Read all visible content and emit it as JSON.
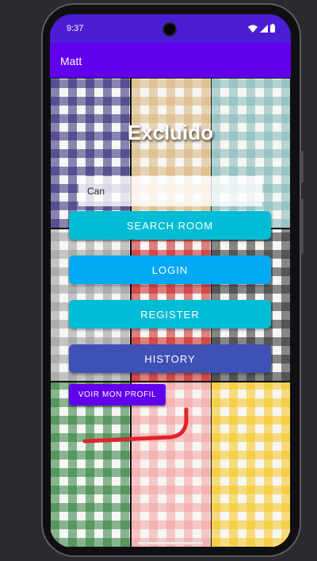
{
  "status_bar": {
    "time": "9:37",
    "icons": [
      "wifi-icon",
      "signal-icon",
      "battery-icon"
    ]
  },
  "app_bar": {
    "title": "Matt"
  },
  "main": {
    "headline": "Excluido",
    "search": {
      "value": "Can",
      "placeholder": ""
    },
    "buttons": {
      "search_room": "SEARCH ROOM",
      "login": "LOGIN",
      "register": "REGISTER",
      "history": "HISTORY",
      "profile": "VOIR MON PROFIL"
    }
  },
  "colors": {
    "status_bar": "#4b1ed6",
    "app_bar": "#6200ee",
    "search_room_button": "#00bcd4",
    "login_button": "#03a9f4",
    "register_button": "#00bcd4",
    "history_button": "#3f51b5",
    "profile_button": "#6200ee",
    "annotation_stroke": "#e0242c",
    "tile_colors": [
      "#2d2577",
      "#d9b57b",
      "#7fb7b7",
      "#9a9a9a",
      "#c81e1e",
      "#2c2c2c",
      "#2e7d3a",
      "#f4a1a1",
      "#f7c51e"
    ]
  }
}
